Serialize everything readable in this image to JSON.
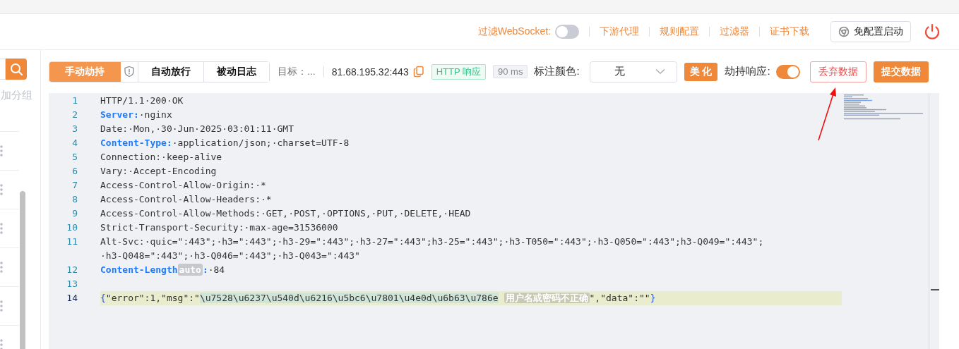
{
  "header": {
    "websocket_filter": {
      "label": "过滤WebSocket:",
      "on": false
    },
    "links": [
      "下游代理",
      "规则配置",
      "过滤器",
      "证书下载"
    ],
    "launch_button": "免配置启动"
  },
  "sidebar": {
    "group_hint": "加分组"
  },
  "toolbar": {
    "modes": [
      {
        "label": "手动劫持",
        "selected": true
      },
      {
        "label": "自动放行",
        "selected": false
      },
      {
        "label": "被动日志",
        "selected": false
      }
    ],
    "target_label": "目标：...",
    "target": "81.68.195.32:443",
    "type_tag": "HTTP 响应",
    "time_tag": "90 ms",
    "mark_color_label": "标注颜色:",
    "mark_color": "无",
    "beautify_button": "美 化",
    "intercept_response": {
      "label": "劫持响应:",
      "on": true
    },
    "discard_button": "丢弃数据",
    "submit_button": "提交数据"
  },
  "editor": {
    "lines": [
      {
        "number": "1",
        "current": false,
        "segments": [
          {
            "kind": "plain",
            "text": "HTTP/1.1·200·OK"
          }
        ]
      },
      {
        "number": "2",
        "current": false,
        "segments": [
          {
            "kind": "key",
            "text": "Server:"
          },
          {
            "kind": "plain",
            "text": "·nginx"
          }
        ]
      },
      {
        "number": "3",
        "current": false,
        "segments": [
          {
            "kind": "plain",
            "text": "Date:·Mon,·30·Jun·2025·03:01:11·GMT"
          }
        ]
      },
      {
        "number": "4",
        "current": false,
        "segments": [
          {
            "kind": "key",
            "text": "Content-Type:"
          },
          {
            "kind": "plain",
            "text": "·application/json;·charset=UTF-8"
          }
        ]
      },
      {
        "number": "5",
        "current": false,
        "segments": [
          {
            "kind": "plain",
            "text": "Connection:·keep-alive"
          }
        ]
      },
      {
        "number": "6",
        "current": false,
        "segments": [
          {
            "kind": "plain",
            "text": "Vary:·Accept-Encoding"
          }
        ]
      },
      {
        "number": "7",
        "current": false,
        "segments": [
          {
            "kind": "plain",
            "text": "Access-Control-Allow-Origin:·*"
          }
        ]
      },
      {
        "number": "8",
        "current": false,
        "segments": [
          {
            "kind": "plain",
            "text": "Access-Control-Allow-Headers:·*"
          }
        ]
      },
      {
        "number": "9",
        "current": false,
        "segments": [
          {
            "kind": "plain",
            "text": "Access-Control-Allow-Methods:·GET,·POST,·OPTIONS,·PUT,·DELETE,·HEAD"
          }
        ]
      },
      {
        "number": "10",
        "current": false,
        "segments": [
          {
            "kind": "plain",
            "text": "Strict-Transport-Security:·max-age=31536000"
          }
        ]
      },
      {
        "number": "11",
        "current": false,
        "segments": [
          {
            "kind": "plain",
            "text": "Alt-Svc:·quic=\":443\";·h3=\":443\";·h3-29=\":443\";·h3-27=\":443\";h3-25=\":443\";·h3-T050=\":443\";·h3-Q050=\":443\";h3-Q049=\":443\";·h3-Q048=\":443\";·h3-Q046=\":443\";·h3-Q043=\":443\""
          }
        ]
      },
      {
        "number": "12",
        "current": false,
        "segments": [
          {
            "kind": "key",
            "text": "Content-Length"
          },
          {
            "kind": "badge",
            "text": "auto"
          },
          {
            "kind": "key",
            "text": ":"
          },
          {
            "kind": "plain",
            "text": "·84"
          }
        ]
      },
      {
        "number": "13",
        "current": false
      },
      {
        "number": "14",
        "current": true,
        "segments": [
          {
            "kind": "brace",
            "text": "{"
          },
          {
            "kind": "plain",
            "text": "\"error\":1,\"msg\":\""
          },
          {
            "kind": "escaped",
            "text": "\\u7528\\u6237\\u540d\\u6216\\u5bc6\\u7801\\u4e0d\\u6b63\\u786e"
          },
          {
            "kind": "decoded",
            "text": "用户名或密码不正确"
          },
          {
            "kind": "plain",
            "text": "\",\"data\":\"\""
          },
          {
            "kind": "brace",
            "text": "}"
          }
        ]
      }
    ]
  }
}
